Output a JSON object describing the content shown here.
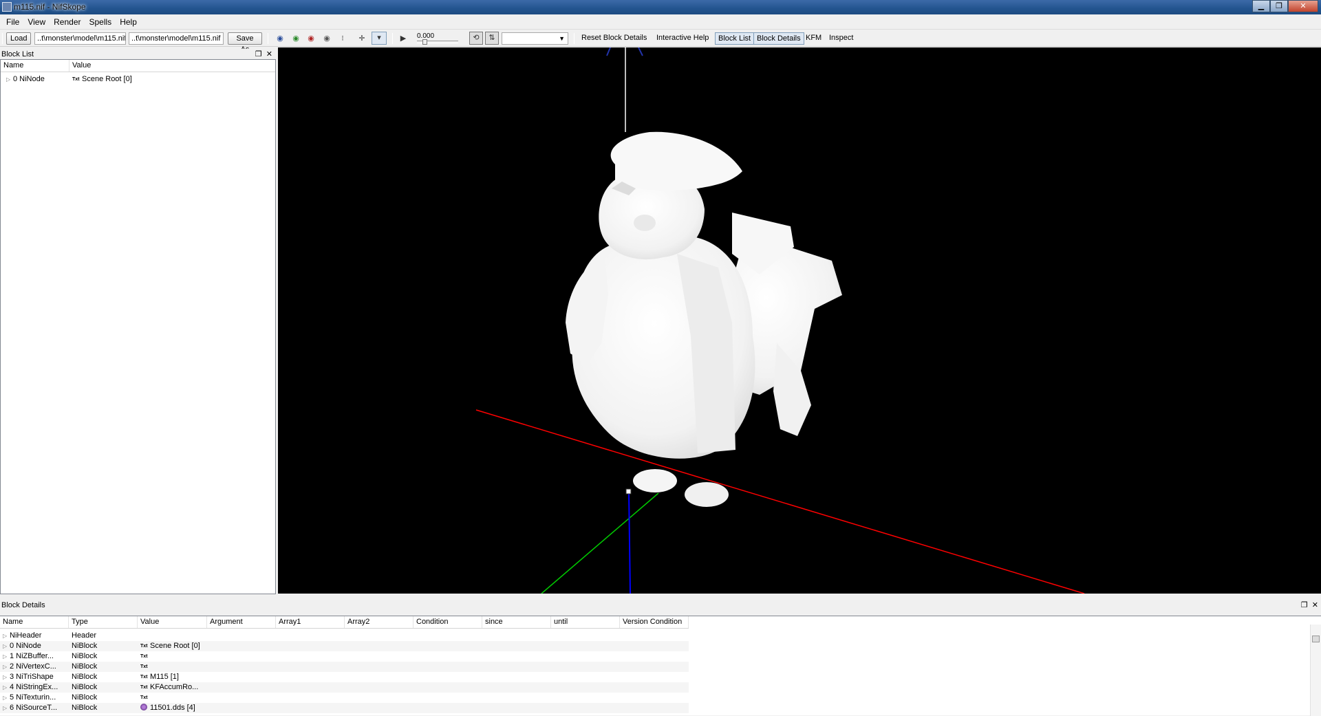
{
  "window": {
    "title": "m115.nif - NifSkope",
    "min": "▁",
    "max": "❐",
    "close": "✕"
  },
  "menu": [
    "File",
    "View",
    "Render",
    "Spells",
    "Help"
  ],
  "toolbar": {
    "load_label": "Load",
    "load_path": "..t\\monster\\model\\m115.nif",
    "save_path": "..t\\monster\\model\\m115.nif",
    "save_as_label": "Save As",
    "time_value": "0.000",
    "reset_block_details": "Reset Block Details",
    "interactive_help": "Interactive Help",
    "block_list": "Block List",
    "block_details": "Block Details",
    "kfm": "KFM",
    "inspect": "Inspect"
  },
  "block_list": {
    "title": "Block List",
    "columns": [
      "Name",
      "Value"
    ],
    "rows": [
      {
        "name": "0 NiNode",
        "value": "Scene Root [0]",
        "value_icon": "Txt"
      }
    ]
  },
  "block_details": {
    "title": "Block Details",
    "columns": [
      "Name",
      "Type",
      "Value",
      "Argument",
      "Array1",
      "Array2",
      "Condition",
      "since",
      "until",
      "Version Condition"
    ],
    "rows": [
      {
        "name": "NiHeader",
        "type": "Header",
        "icon": "",
        "value": ""
      },
      {
        "name": "0 NiNode",
        "type": "NiBlock",
        "icon": "Txt",
        "value": "Scene Root [0]"
      },
      {
        "name": "1 NiZBuffer...",
        "type": "NiBlock",
        "icon": "Txt",
        "value": ""
      },
      {
        "name": "2 NiVertexC...",
        "type": "NiBlock",
        "icon": "Txt",
        "value": ""
      },
      {
        "name": "3 NiTriShape",
        "type": "NiBlock",
        "icon": "Txt",
        "value": "M115 [1]"
      },
      {
        "name": "4 NiStringEx...",
        "type": "NiBlock",
        "icon": "Txt",
        "value": "KFAccumRo..."
      },
      {
        "name": "5 NiTexturin...",
        "type": "NiBlock",
        "icon": "Txt",
        "value": ""
      },
      {
        "name": "6 NiSourceT...",
        "type": "NiBlock",
        "icon": "img",
        "value": "11501.dds [4]"
      }
    ]
  },
  "colors": {
    "viewport_bg": "#000000",
    "axis_x": "#ff0000",
    "axis_y": "#00cc00",
    "axis_z": "#0000ff",
    "model": "#ffffff"
  }
}
